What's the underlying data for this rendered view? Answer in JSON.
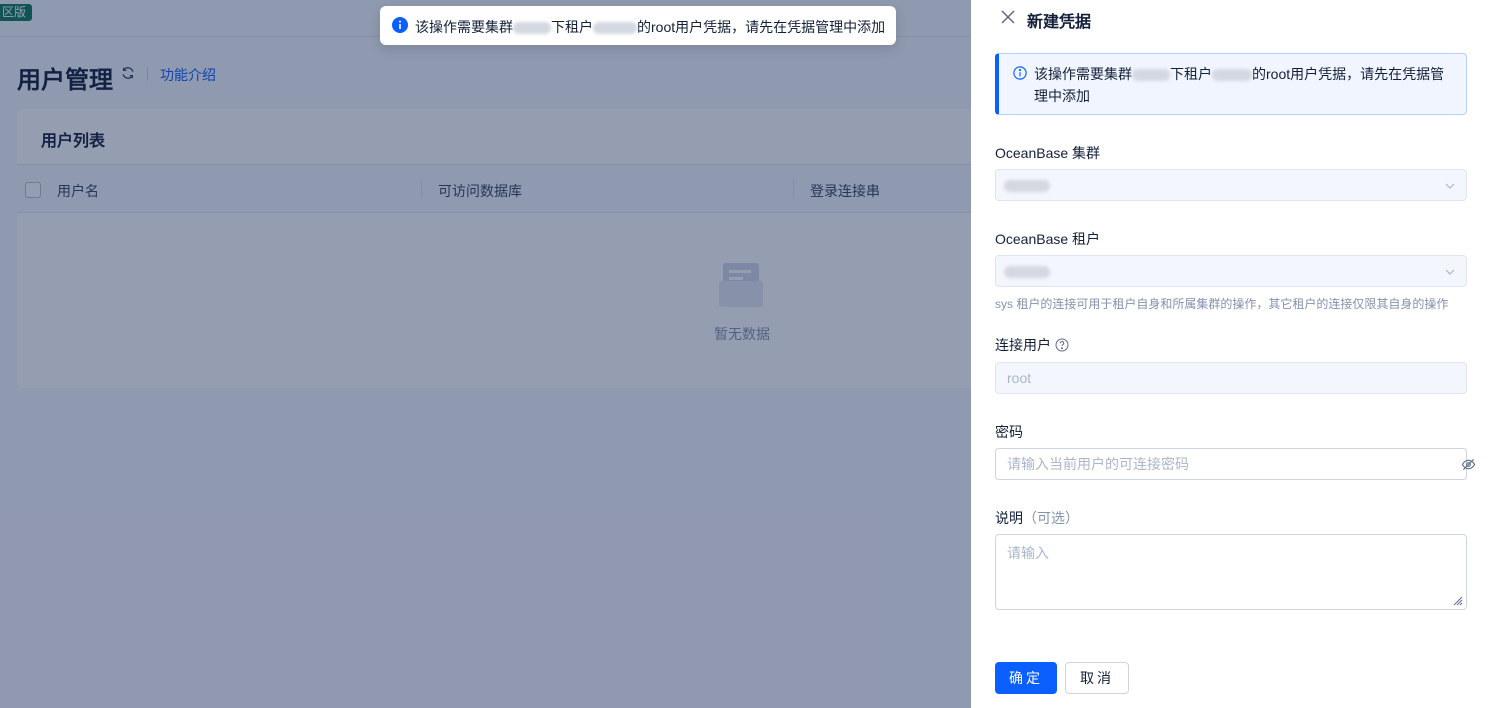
{
  "background": {
    "edition_tag": "区版",
    "page_title": "用户管理",
    "intro_link": "功能介绍",
    "card_title": "用户列表",
    "columns": [
      "用户名",
      "可访问数据库",
      "登录连接串"
    ],
    "empty_text": "暂无数据"
  },
  "toast": {
    "text_prefix": "该操作需要集群",
    "text_mid": "下租户",
    "text_suffix": "的root用户凭据，请先在凭据管理中添加"
  },
  "drawer": {
    "title": "新建凭据",
    "alert": {
      "text_prefix": "该操作需要集群",
      "text_mid": "下租户",
      "text_suffix": "的root用户凭据，请先在凭据管理中添加"
    },
    "cluster_label": "OceanBase 集群",
    "tenant_label": "OceanBase 租户",
    "tenant_hint": "sys 租户的连接可用于租户自身和所属集群的操作，其它租户的连接仅限其自身的操作",
    "user_label": "连接用户",
    "user_value": "root",
    "password_label": "密码",
    "password_placeholder": "请输入当前用户的可连接密码",
    "desc_label": "说明",
    "desc_optional": "（可选）",
    "desc_placeholder": "请输入",
    "confirm_label": "确定",
    "cancel_label": "取消"
  }
}
